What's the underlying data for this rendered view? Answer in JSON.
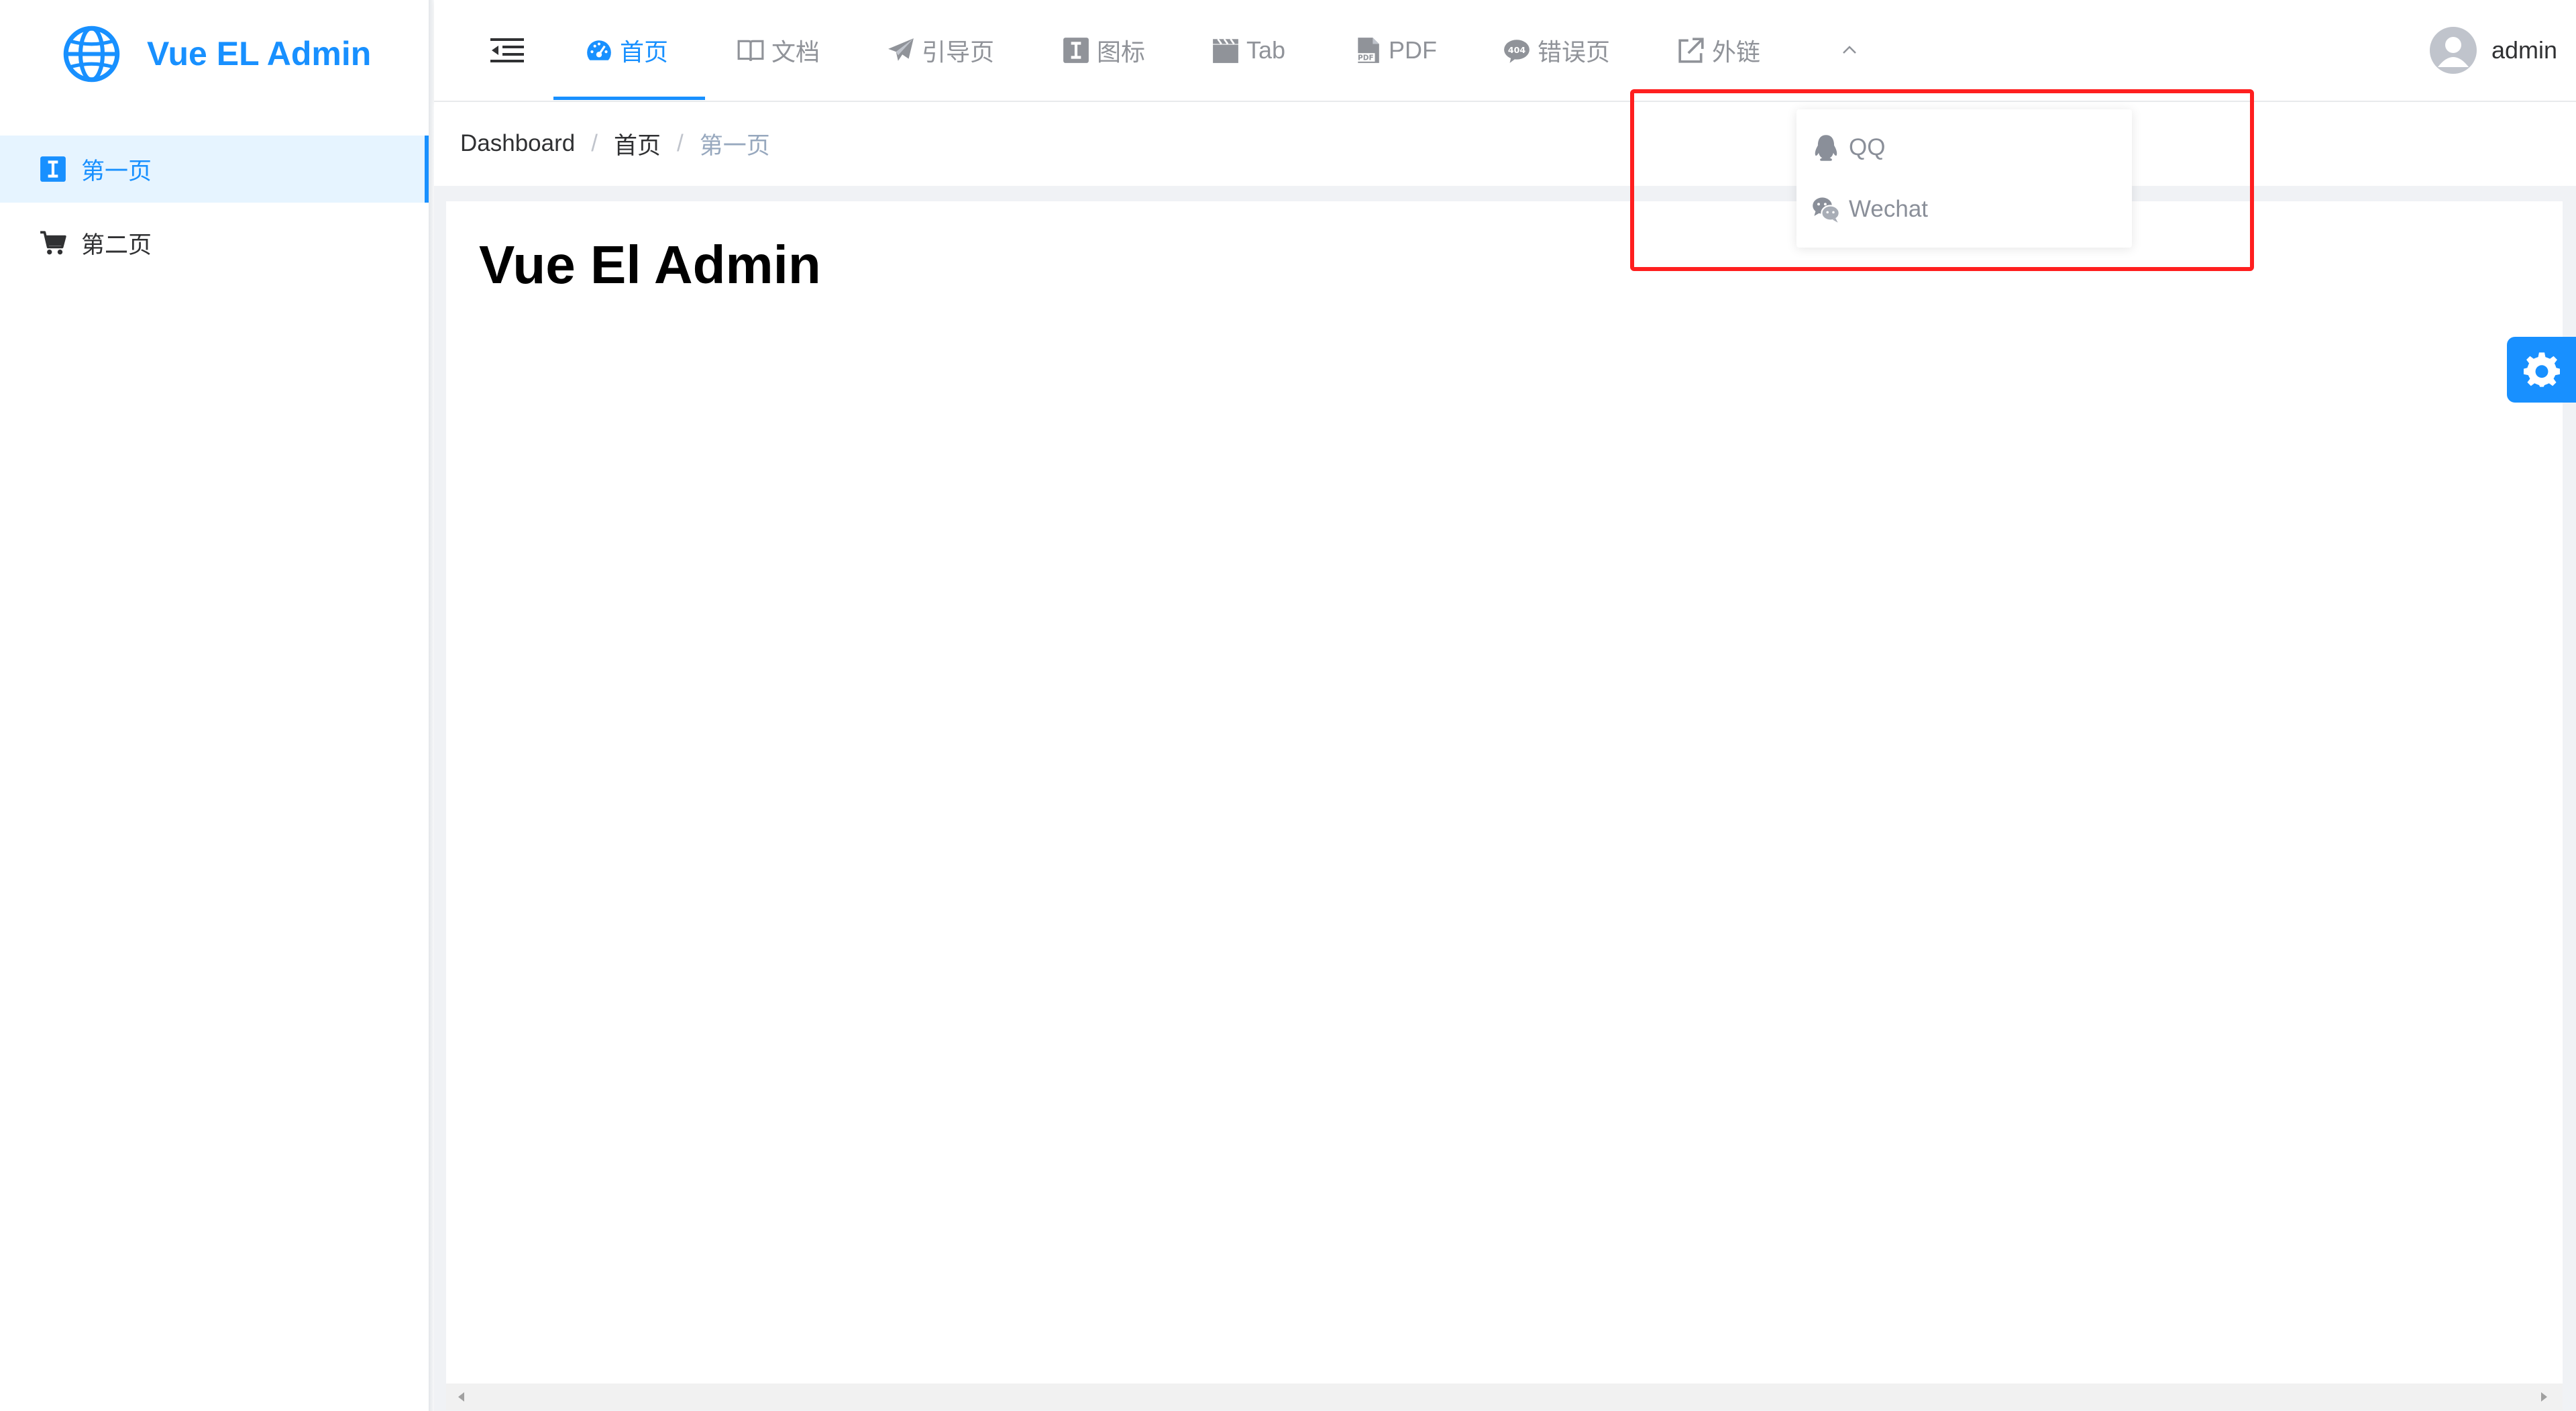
{
  "app": {
    "title": "Vue EL Admin",
    "brand_color": "#1890ff"
  },
  "sidebar": {
    "items": [
      {
        "label": "第一页",
        "icon": "text-cursor-icon",
        "active": true
      },
      {
        "label": "第二页",
        "icon": "shopping-cart-icon",
        "active": false
      }
    ]
  },
  "topnav": {
    "items": [
      {
        "label": "首页",
        "icon": "dashboard-icon",
        "active": true
      },
      {
        "label": "文档",
        "icon": "book-icon",
        "active": false
      },
      {
        "label": "引导页",
        "icon": "paper-plane-icon",
        "active": false
      },
      {
        "label": "图标",
        "icon": "text-cursor-icon",
        "active": false
      },
      {
        "label": "Tab",
        "icon": "clapperboard-icon",
        "active": false
      },
      {
        "label": "PDF",
        "icon": "pdf-file-icon",
        "active": false
      },
      {
        "label": "错误页",
        "icon": "error-404-icon",
        "active": false
      },
      {
        "label": "外链",
        "icon": "external-link-icon",
        "active": false
      }
    ],
    "more_caret": "chevron-up-icon"
  },
  "user": {
    "name": "admin"
  },
  "breadcrumb": {
    "items": [
      "Dashboard",
      "首页",
      "第一页"
    ],
    "separator": "/"
  },
  "main": {
    "title": "Vue El Admin"
  },
  "dropdown": {
    "items": [
      {
        "label": "QQ",
        "icon": "qq-penguin-icon"
      },
      {
        "label": "Wechat",
        "icon": "wechat-icon"
      }
    ],
    "highlight_color": "#ff1f1f"
  }
}
